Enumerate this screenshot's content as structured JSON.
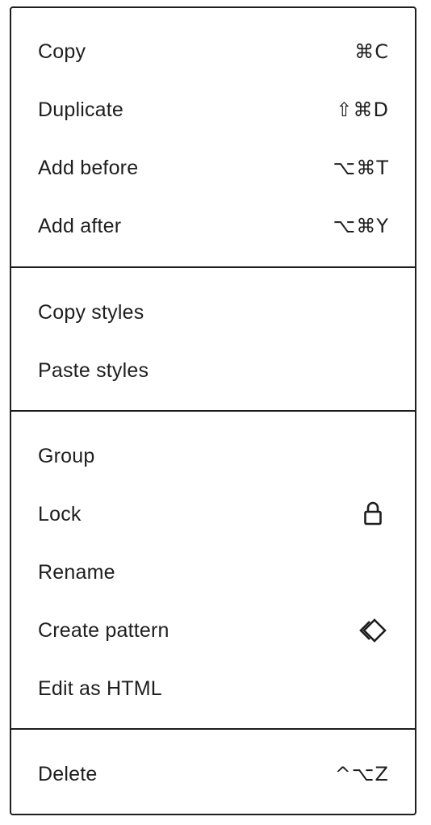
{
  "menu": {
    "items": [
      {
        "label": "Copy",
        "shortcut": "⌘C"
      },
      {
        "label": "Duplicate",
        "shortcut": "⇧⌘D"
      },
      {
        "label": "Add before",
        "shortcut": "⌥⌘T"
      },
      {
        "label": "Add after",
        "shortcut": "⌥⌘Y"
      },
      {
        "label": "Copy styles"
      },
      {
        "label": "Paste styles"
      },
      {
        "label": "Group"
      },
      {
        "label": "Lock",
        "icon": "lock-icon"
      },
      {
        "label": "Rename"
      },
      {
        "label": "Create pattern",
        "icon": "pattern-icon"
      },
      {
        "label": "Edit as HTML"
      },
      {
        "label": "Delete",
        "shortcut": "^⌥Z"
      }
    ]
  },
  "colors": {
    "text": "#1e1e1e",
    "border": "#1e1e1e",
    "background": "#ffffff"
  }
}
